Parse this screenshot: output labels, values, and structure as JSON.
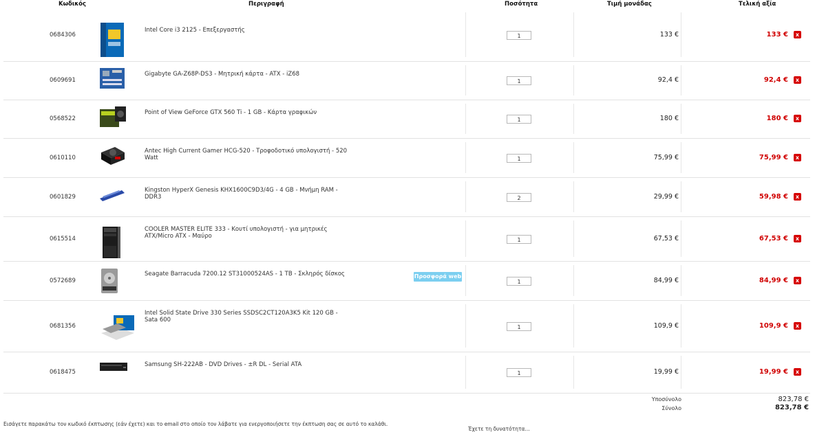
{
  "header": {
    "code": "Κωδικός",
    "description": "Περιγραφή",
    "quantity": "Ποσότητα",
    "unit_price": "Τιμή μονάδας",
    "total_value": "Τελική αξία"
  },
  "items": [
    {
      "code": "0684306",
      "desc": "Intel Core i3 2125 - Επεξεργαστής",
      "qty": "1",
      "unit": "133 €",
      "total": "133 €",
      "thumb": "cpu-box"
    },
    {
      "code": "0609691",
      "desc": "Gigabyte GA-Z68P-DS3 - Μητρική κάρτα - ATX - iZ68",
      "qty": "1",
      "unit": "92,4 €",
      "total": "92,4 €",
      "thumb": "motherboard"
    },
    {
      "code": "0568522",
      "desc": "Point of View GeForce GTX 560 Ti - 1 GB - Κάρτα γραφικών",
      "qty": "1",
      "unit": "180 €",
      "total": "180 €",
      "thumb": "gpu-box"
    },
    {
      "code": "0610110",
      "desc": "Antec High Current Gamer HCG-520 - Τροφοδοτικό υπολογιστή - 520 Watt",
      "qty": "1",
      "unit": "75,99 €",
      "total": "75,99 €",
      "thumb": "psu"
    },
    {
      "code": "0601829",
      "desc": "Kingston HyperX Genesis KHX1600C9D3/4G - 4 GB - Μνήμη RAM - DDR3",
      "qty": "2",
      "unit": "29,99 €",
      "total": "59,98 €",
      "thumb": "ram"
    },
    {
      "code": "0615514",
      "desc": "COOLER MASTER ELITE 333 - Κουτί υπολογιστή - για μητρικές ATX/Micro ATX - Μαύρο",
      "qty": "1",
      "unit": "67,53 €",
      "total": "67,53 €",
      "thumb": "pc-case"
    },
    {
      "code": "0572689",
      "desc": "Seagate Barracuda 7200.12 ST31000524AS - 1 TB - Σκληρός δίσκος",
      "qty": "1",
      "unit": "84,99 €",
      "total": "84,99 €",
      "thumb": "hdd",
      "badge": "Προσφορά web"
    },
    {
      "code": "0681356",
      "desc": "Intel Solid State Drive 330 Series SSDSC2CT120A3K5 Kit 120 GB - Sata 600",
      "qty": "1",
      "unit": "109,9 €",
      "total": "109,9 €",
      "thumb": "ssd-box"
    },
    {
      "code": "0618475",
      "desc": "Samsung SH-222AB - DVD Drives - ±R DL - Serial ATA",
      "qty": "1",
      "unit": "19,99 €",
      "total": "19,99 €",
      "thumb": "dvd-drive"
    }
  ],
  "delete_glyph": "x",
  "summary": {
    "subtotal_label": "Υποσύνολο",
    "subtotal_value": "823,78 €",
    "total_label": "Σύνολο",
    "total_value": "823,78 €"
  },
  "coupon_text": "Εισάγετε παρακάτω τον κωδικό έκπτωσης (εάν έχετε) και το email στο οποίο τον λάβατε για ενεργοποιήσετε την έκπτωση σας σε αυτό το καλάθι.",
  "bottom_right_text": "Έχετε τη δυνατότητα..."
}
